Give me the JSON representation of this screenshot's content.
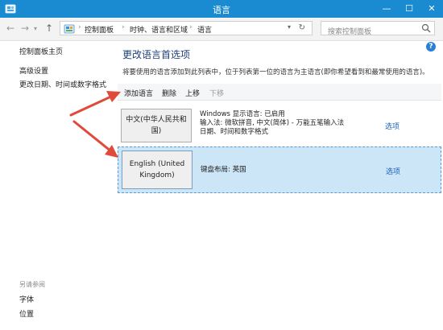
{
  "window": {
    "title": "语言",
    "min_glyph": "—",
    "max_glyph": "☐",
    "close_glyph": "✕"
  },
  "nav": {
    "back_glyph": "←",
    "forward_glyph": "→",
    "recent_glyph": "▾",
    "up_glyph": "↑",
    "breadcrumb": [
      "控制面板",
      "时钟、语言和区域",
      "语言"
    ],
    "separator": "›",
    "dropdown_glyph": "▾",
    "refresh_glyph": "↻"
  },
  "search": {
    "placeholder": "搜索控制面板"
  },
  "help_glyph": "?",
  "sidebar": {
    "home": "控制面板主页",
    "links": [
      "高级设置",
      "更改日期、时间或数字格式"
    ],
    "see_also_title": "另请参阅",
    "see_also": [
      "字体",
      "位置"
    ]
  },
  "main": {
    "title": "更改语言首选项",
    "description": "将要使用的语言添加到此列表中，位于列表第一位的语言为主语言(即你希望看到和最常使用的语言)。"
  },
  "toolbar": {
    "add": "添加语言",
    "remove": "删除",
    "move_up": "上移",
    "move_down": "下移"
  },
  "languages": [
    {
      "name": "中文(中华人民共和国)",
      "details": [
        "Windows 显示语言: 已启用",
        "输入法: 微软拼音, 中文(简体) - 万能五笔输入法",
        "日期、时间和数字格式"
      ],
      "options": "选项",
      "selected": false
    },
    {
      "name": "English (United Kingdom)",
      "details": [
        "键盘布局: 英国"
      ],
      "options": "选项",
      "selected": true
    }
  ],
  "colors": {
    "titlebar": "#1a8bd1",
    "selected_row": "#cde6f7",
    "link": "#1a62b8",
    "annotation_arrow": "#e04a3a"
  }
}
